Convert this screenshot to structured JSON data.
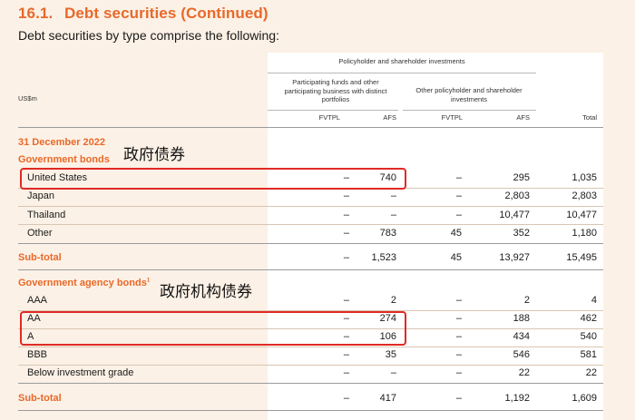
{
  "title": {
    "number": "16.1.",
    "text": "Debt securities (Continued)"
  },
  "subtitle": "Debt securities by type comprise the following:",
  "header": {
    "group": "Policyholder and shareholder investments",
    "sub1": [
      "Participating funds and other",
      "participating business with distinct",
      "portfolios"
    ],
    "sub2": [
      "Other policyholder and shareholder",
      "investments"
    ],
    "unit": "US$m",
    "columns": [
      "FVTPL",
      "AFS",
      "FVTPL",
      "AFS",
      "Total"
    ]
  },
  "date": "31 December 2022",
  "gov": {
    "heading": "Government bonds",
    "annotation": "政府债券",
    "rows": [
      {
        "label": "United States",
        "values": [
          "–",
          "740",
          "–",
          "295",
          "1,035"
        ]
      },
      {
        "label": "Japan",
        "values": [
          "–",
          "–",
          "–",
          "2,803",
          "2,803"
        ]
      },
      {
        "label": "Thailand",
        "values": [
          "–",
          "–",
          "–",
          "10,477",
          "10,477"
        ]
      },
      {
        "label": "Other",
        "values": [
          "–",
          "783",
          "45",
          "352",
          "1,180"
        ]
      }
    ],
    "subtotal": {
      "label": "Sub-total",
      "values": [
        "–",
        "1,523",
        "45",
        "13,927",
        "15,495"
      ]
    }
  },
  "agency": {
    "heading": "Government agency bonds",
    "footnote": "1",
    "annotation": "政府机构债券",
    "rows": [
      {
        "label": "AAA",
        "values": [
          "–",
          "2",
          "–",
          "2",
          "4"
        ]
      },
      {
        "label": "AA",
        "values": [
          "–",
          "274",
          "–",
          "188",
          "462"
        ]
      },
      {
        "label": "A",
        "values": [
          "–",
          "106",
          "–",
          "434",
          "540"
        ]
      },
      {
        "label": "BBB",
        "values": [
          "–",
          "35",
          "–",
          "546",
          "581"
        ]
      },
      {
        "label": "Below investment grade",
        "values": [
          "–",
          "–",
          "–",
          "22",
          "22"
        ]
      }
    ],
    "subtotal": {
      "label": "Sub-total",
      "values": [
        "–",
        "417",
        "–",
        "1,192",
        "1,609"
      ]
    }
  },
  "colors": {
    "accent": "#e8692a",
    "highlight": "#e02a25",
    "background": "#fcf1e6"
  }
}
